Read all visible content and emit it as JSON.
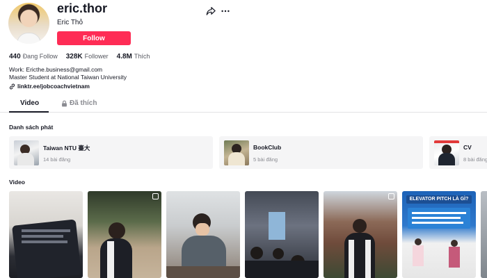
{
  "profile": {
    "username": "eric.thor",
    "nickname": "Eric Thỏ",
    "follow_label": "Follow",
    "stats": [
      {
        "value": "440",
        "label": "Đang Follow"
      },
      {
        "value": "328K",
        "label": "Follower"
      },
      {
        "value": "4.8M",
        "label": "Thích"
      }
    ],
    "bio_lines": [
      "Work: Ericthe.business@gmail.com",
      "Master Student at National Taiwan University"
    ],
    "link": "linktr.ee/jobcoachvietnam",
    "accent_color": "#fe2c55"
  },
  "tabs": [
    {
      "label": "Video",
      "active": true
    },
    {
      "label": "Đã thích",
      "icon": "lock-icon"
    }
  ],
  "playlists_section": {
    "title": "Danh sách phát",
    "items": [
      {
        "title": "Taiwan NTU 臺大",
        "count": "14 bài đăng"
      },
      {
        "title": "BookClub",
        "count": "5 bài đăng"
      },
      {
        "title": "CV",
        "count": "8 bài đăng"
      }
    ]
  },
  "videos_section": {
    "title": "Video",
    "captions": [
      "",
      "",
      "",
      "",
      "",
      "ELEVATOR PITCH LÀ GÌ?"
    ]
  }
}
